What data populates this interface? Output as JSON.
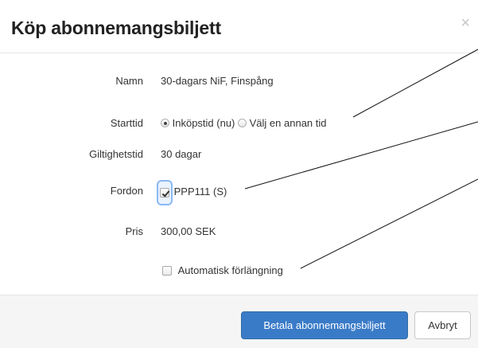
{
  "dialog": {
    "title": "Köp abonnemangsbiljett",
    "close_symbol": "×"
  },
  "form": {
    "name": {
      "label": "Namn",
      "value": "30-dagars NiF, Finspång"
    },
    "start": {
      "label": "Starttid",
      "options": [
        {
          "label": "Inköpstid (nu)",
          "selected": true
        },
        {
          "label": "Välj en annan tid",
          "selected": false
        }
      ]
    },
    "validity": {
      "label": "Giltighetstid",
      "value": "30 dagar"
    },
    "vehicle": {
      "label": "Fordon",
      "value": "PPP111 (S)",
      "checked": true
    },
    "price": {
      "label": "Pris",
      "value": "300,00 SEK"
    },
    "auto_renew": {
      "label": "Automatisk förlängning",
      "checked": false
    }
  },
  "footer": {
    "pay_label": "Betala abonnemangsbiljett",
    "cancel_label": "Avbryt"
  },
  "colors": {
    "primary": "#3a7bc8",
    "footer_bg": "#f5f5f5"
  }
}
